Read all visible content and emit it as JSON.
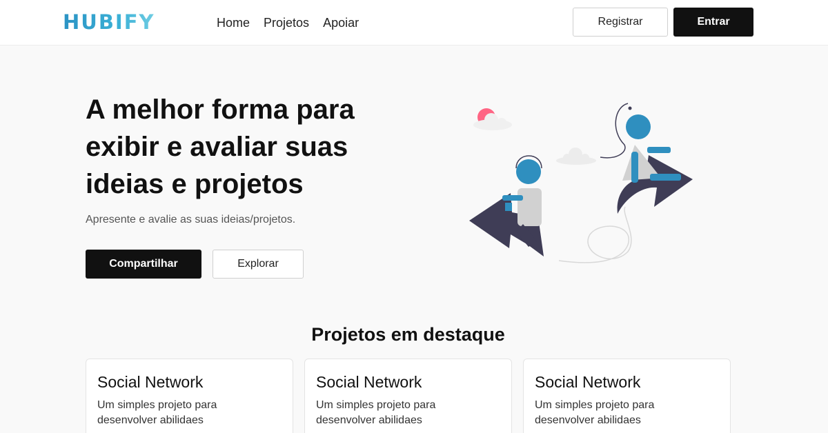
{
  "header": {
    "logo": "HUBIFY",
    "nav": [
      {
        "label": "Home"
      },
      {
        "label": "Projetos"
      },
      {
        "label": "Apoiar"
      }
    ],
    "register_label": "Registrar",
    "login_label": "Entrar"
  },
  "hero": {
    "title": "A melhor forma para exibir e avaliar suas ideias e projetos",
    "subtitle": "Apresente e avalie as suas ideias/projetos.",
    "share_label": "Compartilhar",
    "explore_label": "Explorar"
  },
  "featured": {
    "title": "Projetos em destaque",
    "cards": [
      {
        "title": "Social Network",
        "description": "Um simples projeto para desenvolver abilidaes"
      },
      {
        "title": "Social Network",
        "description": "Um simples projeto para desenvolver abilidaes"
      },
      {
        "title": "Social Network",
        "description": "Um simples projeto para desenvolver abilidaes"
      }
    ]
  },
  "colors": {
    "brand": "#2b93c4",
    "primary_button": "#111111",
    "figure_accent": "#2f8fbf",
    "arrow": "#3f3d56",
    "sun": "#ff6584"
  }
}
